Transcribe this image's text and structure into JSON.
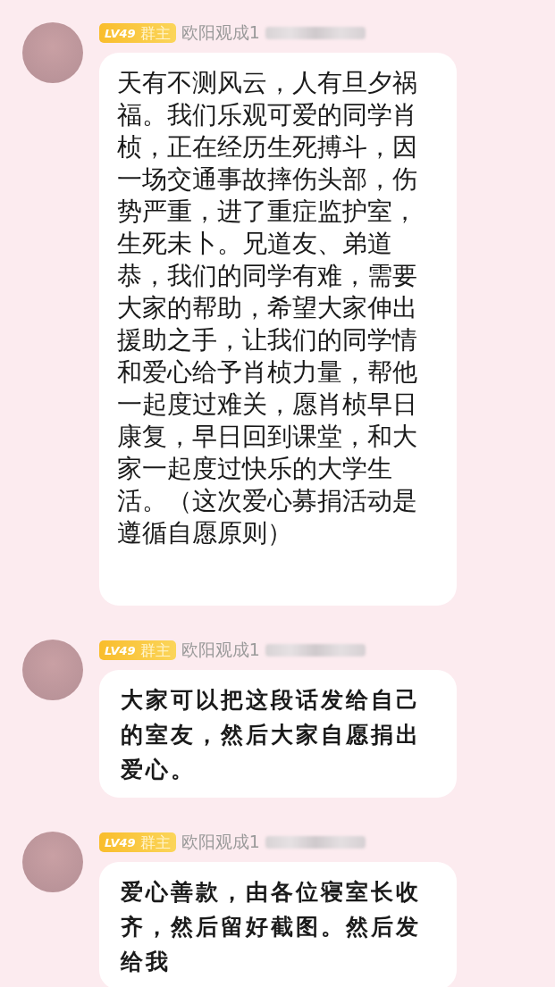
{
  "messages": [
    {
      "level_badge": "LV49",
      "role_badge": "群主",
      "sender": "欧阳观成1",
      "kind": "plain",
      "text": "天有不测风云，人有旦夕祸福。我们乐观可爱的同学肖桢，正在经历生死搏斗，因一场交通事故摔伤头部，伤势严重，进了重症监护室，生死未卜。兄道友、弟道恭，我们的同学有难，需要大家的帮助，希望大家伸出援助之手，让我们的同学情和爱心给予肖桢力量，帮他一起度过难关，愿肖桢早日康复，早日回到课堂，和大家一起度过快乐的大学生活。（这次爱心募捐活动是遵循自愿原则）"
    },
    {
      "level_badge": "LV49",
      "role_badge": "群主",
      "sender": "欧阳观成1",
      "kind": "handwritten",
      "text": "大家可以把这段话发给自己的室友，然后大家自愿捐出爱心。"
    },
    {
      "level_badge": "LV49",
      "role_badge": "群主",
      "sender": "欧阳观成1",
      "kind": "handwritten",
      "text": "爱心善款，由各位寝室长收齐，然后留好截图。然后发给我"
    }
  ]
}
